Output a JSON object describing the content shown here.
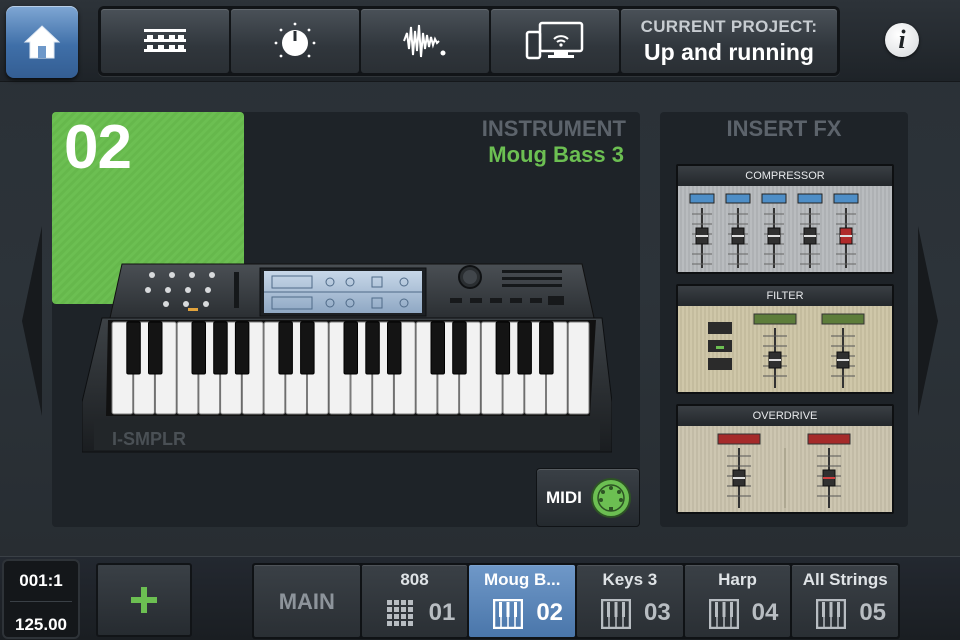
{
  "header": {
    "project_label": "CURRENT PROJECT:",
    "project_name": "Up and running",
    "info_label": "i",
    "tools": [
      {
        "icon": "mixer-icon"
      },
      {
        "icon": "knob-icon"
      },
      {
        "icon": "waveform-icon"
      },
      {
        "icon": "devices-wifi-icon"
      }
    ]
  },
  "instrument": {
    "slot_number": "02",
    "section_label": "INSTRUMENT",
    "name": "Moug Bass 3",
    "synth_brand": "I-SMPLR",
    "midi_label": "MIDI"
  },
  "fx": {
    "section_label": "INSERT FX",
    "units": [
      {
        "name": "COMPRESSOR"
      },
      {
        "name": "FILTER"
      },
      {
        "name": "OVERDRIVE"
      }
    ]
  },
  "transport": {
    "position": "001:1",
    "tempo": "125.00"
  },
  "tracks": [
    {
      "name": "MAIN",
      "number": "",
      "icon": "",
      "active": false
    },
    {
      "name": "808",
      "number": "01",
      "icon": "drum-pads-icon",
      "active": false
    },
    {
      "name": "Moug B...",
      "number": "02",
      "icon": "keyboard-icon",
      "active": true
    },
    {
      "name": "Keys 3",
      "number": "03",
      "icon": "keyboard-icon",
      "active": false
    },
    {
      "name": "Harp",
      "number": "04",
      "icon": "keyboard-icon",
      "active": false
    },
    {
      "name": "All Strings",
      "number": "05",
      "icon": "keyboard-icon",
      "active": false
    }
  ],
  "colors": {
    "accent_green": "#6cbf52",
    "active_blue": "#5b86ba",
    "home_blue": "#4a79b3"
  }
}
